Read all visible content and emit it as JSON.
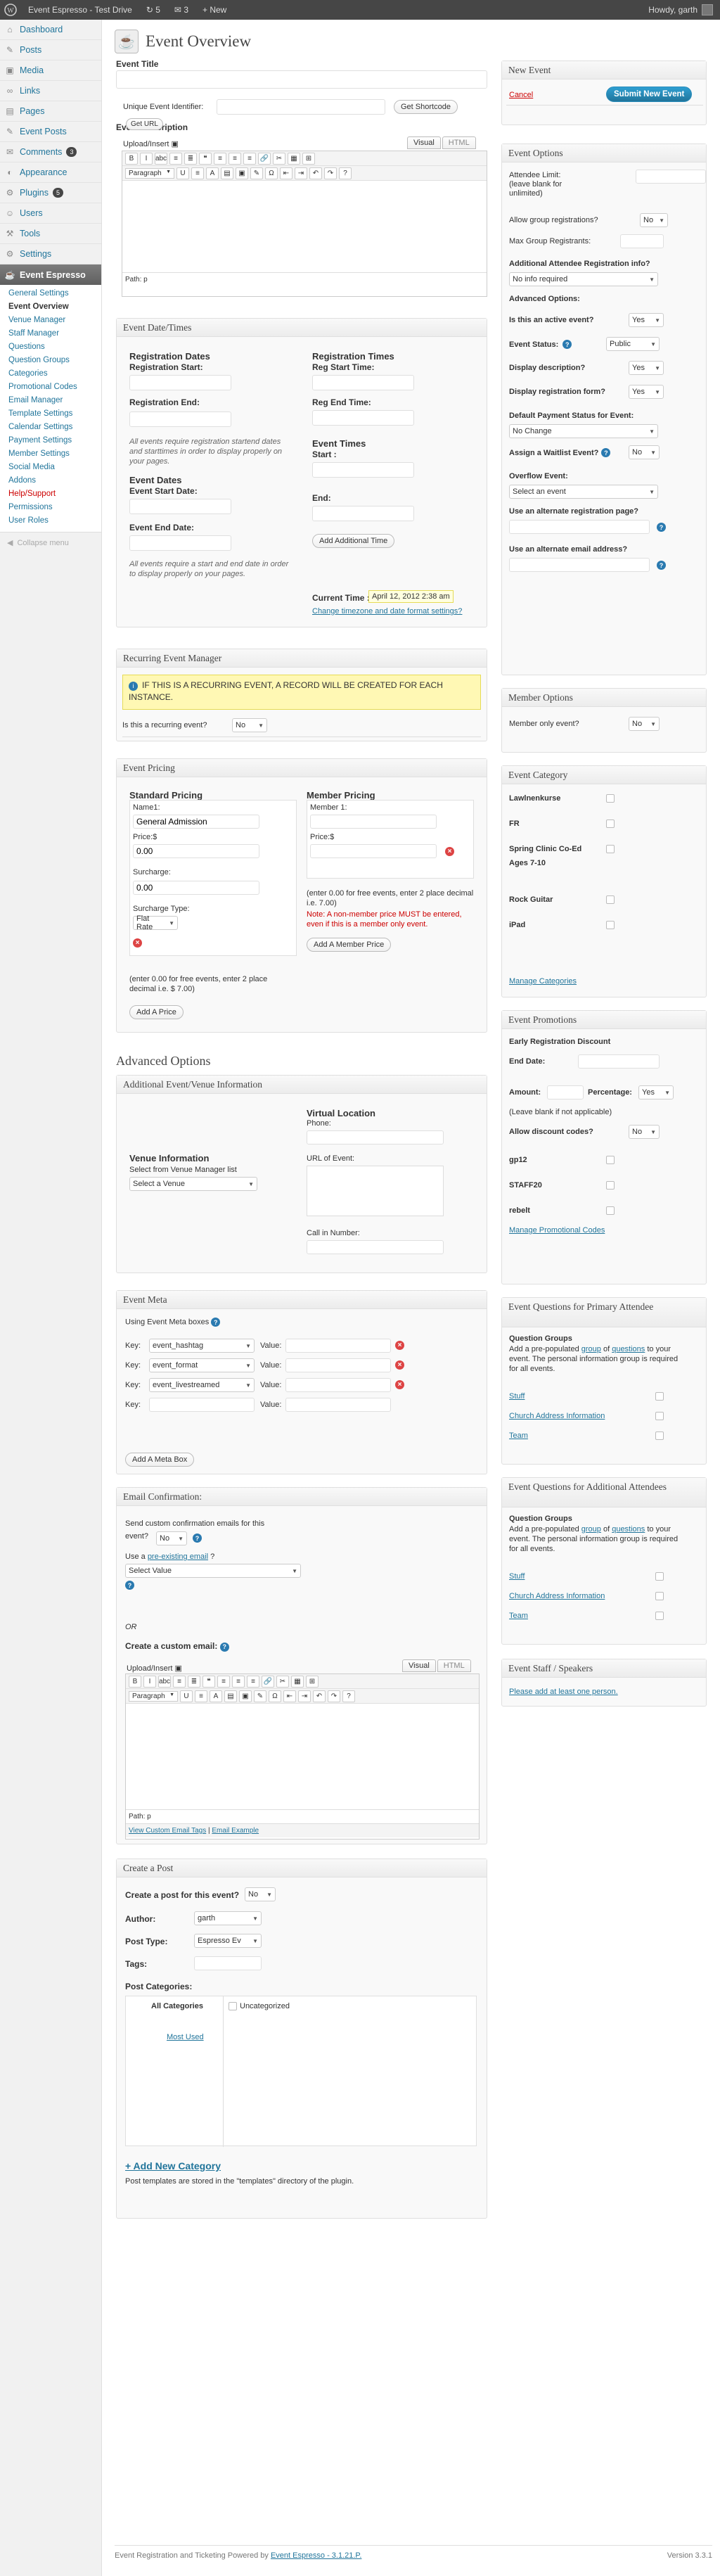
{
  "adminbar": {
    "site": "Event Espresso - Test Drive",
    "updates": "5",
    "comments": "3",
    "new": "+ New",
    "howdy": "Howdy, garth"
  },
  "menu": {
    "items": [
      {
        "label": "Dashboard",
        "icon": "⌂",
        "name": "dashboard"
      },
      {
        "label": "Posts",
        "icon": "✎",
        "name": "posts"
      },
      {
        "label": "Media",
        "icon": "▣",
        "name": "media"
      },
      {
        "label": "Links",
        "icon": "∞",
        "name": "links"
      },
      {
        "label": "Pages",
        "icon": "▤",
        "name": "pages"
      },
      {
        "label": "Event Posts",
        "icon": "✎",
        "name": "event-posts"
      },
      {
        "label": "Comments",
        "icon": "✉",
        "name": "comments",
        "badge": "3"
      },
      {
        "label": "Appearance",
        "icon": "◐",
        "name": "appearance"
      },
      {
        "label": "Plugins",
        "icon": "⚙",
        "name": "plugins",
        "badge": "5"
      },
      {
        "label": "Users",
        "icon": "☺",
        "name": "users"
      },
      {
        "label": "Tools",
        "icon": "⚒",
        "name": "tools"
      },
      {
        "label": "Settings",
        "icon": "⚙",
        "name": "settings"
      }
    ],
    "active": "Event Espresso",
    "subitems": [
      "General Settings",
      "Event Overview",
      "Venue Manager",
      "Staff Manager",
      "Questions",
      "Question Groups",
      "Categories",
      "Promotional Codes",
      "Email Manager",
      "Template Settings",
      "Calendar Settings",
      "Payment Settings",
      "Member Settings",
      "Social Media",
      "Addons",
      "Help/Support",
      "Permissions",
      "User Roles"
    ],
    "collapse": "Collapse menu"
  },
  "page": {
    "title": "Event Overview",
    "event_title_label": "Event Title",
    "uid_label": "Unique Event Identifier:",
    "shortcode_btn": "Get Shortcode",
    "desc_label": "Event Description",
    "geturl": "Get URL"
  },
  "editor": {
    "upload": "Upload/Insert",
    "visual": "Visual",
    "html": "HTML",
    "paragraph": "Paragraph",
    "path": "Path: p",
    "tb1": [
      "B",
      "I",
      "abc",
      "≡",
      "≣",
      "❝",
      "≡",
      "≡",
      "≡",
      "🔗",
      "✂",
      "▦",
      "⊞"
    ],
    "tb2": [
      "U",
      "≡",
      "A",
      "▤",
      "▣",
      "✎",
      "Ω",
      "⇤",
      "⇥",
      "↶",
      "↷",
      "?"
    ]
  },
  "datetimes": {
    "title": "Event Date/Times",
    "reg_dates": "Registration Dates",
    "reg_start": "Registration Start:",
    "reg_end": "Registration End:",
    "reg_note": "All events require registration startend dates and starttimes in order to display properly on your pages.",
    "ev_dates": "Event Dates",
    "ev_start": "Event Start Date:",
    "ev_end": "Event End Date:",
    "ev_note": "All events require a start and end date in order to display properly on your pages.",
    "reg_times": "Registration Times",
    "reg_start_time": "Reg Start Time:",
    "reg_end_time": "Reg End Time:",
    "ev_times": "Event Times",
    "start": "Start :",
    "end": "End:",
    "add_time": "Add Additional Time",
    "current_time_label": "Current Time :",
    "current_time": "April 12, 2012 2:38 am",
    "change_tz": "Change timezone and date format settings?"
  },
  "recurring": {
    "title": "Recurring Event Manager",
    "warning": "IF THIS IS A RECURRING EVENT, A RECORD WILL BE CREATED FOR EACH INSTANCE.",
    "question": "Is this a recurring event?",
    "value": "No"
  },
  "pricing": {
    "title": "Event Pricing",
    "standard": "Standard Pricing",
    "name_label": "Name1:",
    "name_value": "General Admission",
    "price_label": "Price:$",
    "price_value": "0.00",
    "surcharge_label": "Surcharge:",
    "surcharge_value": "0.00",
    "surcharge_type_label": "Surcharge Type:",
    "surcharge_type": "Flat Rate",
    "std_note": "(enter 0.00 for free events, enter 2 place decimal i.e. $ 7.00)",
    "add_price": "Add A Price",
    "member": "Member Pricing",
    "member_name": "Member 1:",
    "member_price": "Price:$",
    "member_note": "(enter 0.00 for free events, enter 2 place decimal i.e. 7.00)",
    "member_warn": "Note: A non-member price MUST be entered, even if this is a member only event.",
    "add_member": "Add A Member Price"
  },
  "advanced_title": "Advanced Options",
  "venue": {
    "title": "Additional Event/Venue Information",
    "venue_info": "Venue Information",
    "select_label": "Select from Venue Manager list",
    "select": "Select a Venue",
    "virtual": "Virtual Location",
    "phone": "Phone:",
    "url": "URL of Event:",
    "cell": "Call in Number:"
  },
  "meta": {
    "title": "Event Meta",
    "using": "Using Event Meta boxes",
    "key": "Key:",
    "value": "Value:",
    "keys": [
      "event_hashtag",
      "event_format",
      "event_livestreamed",
      ""
    ],
    "add": "Add A Meta Box"
  },
  "email": {
    "title": "Email Confirmation:",
    "send": "Send custom confirmation emails for this event?",
    "send_value": "No",
    "use": "Use a",
    "preexisting": "pre-existing email",
    "use_end": "?",
    "select": "Select Value",
    "or": "OR",
    "custom": "Create a custom email:",
    "view_tags": "View Custom Email Tags",
    "example": "Email Example"
  },
  "createpost": {
    "title": "Create a Post",
    "create": "Create a post for this event?",
    "create_value": "No",
    "author": "Author:",
    "author_value": "garth",
    "type": "Post Type:",
    "type_value": "Espresso Ev",
    "tags": "Tags:",
    "categories": "Post Categories:",
    "all_cats": "All Categories",
    "most_used": "Most Used",
    "uncategorized": "Uncategorized",
    "add_cat": "+ Add New Category",
    "templates_note": "Post templates are stored in the \"templates\" directory of the plugin."
  },
  "newevent": {
    "title": "New Event",
    "cancel": "Cancel",
    "submit": "Submit New Event"
  },
  "options": {
    "title": "Event Options",
    "limit": "Attendee Limit:",
    "limit_note": "(leave blank for unlimited)",
    "group": "Allow group registrations?",
    "group_value": "No",
    "max_group": "Max Group Registrants:",
    "additional": "Additional Attendee Registration info?",
    "additional_value": "No info required",
    "advanced": "Advanced Options:",
    "active": "Is this an active event?",
    "active_value": "Yes",
    "status": "Event Status:",
    "status_value": "Public",
    "display_desc": "Display description?",
    "display_desc_value": "Yes",
    "display_form": "Display registration form?",
    "display_form_value": "Yes",
    "payment_status": "Default Payment Status for Event:",
    "payment_value": "No Change",
    "waitlist": "Assign a Waitlist Event?",
    "waitlist_value": "No",
    "overflow": "Overflow Event:",
    "overflow_value": "Select an event",
    "alt_reg": "Use an alternate registration page?",
    "alt_email": "Use an alternate email address?"
  },
  "member_options": {
    "title": "Member Options",
    "member_only": "Member only event?",
    "member_only_value": "No"
  },
  "category": {
    "title": "Event Category",
    "items": [
      "Lawlnenkurse",
      "FR",
      "Spring Clinic Co-Ed",
      "Ages 7-10",
      "Rock Guitar",
      "iPad"
    ],
    "manage": "Manage Categories"
  },
  "promotions": {
    "title": "Event Promotions",
    "early": "Early Registration Discount",
    "end_date": "End Date:",
    "amount": "Amount:",
    "percentage": "Percentage:",
    "percentage_value": "Yes",
    "blank_note": "(Leave blank if not applicable)",
    "allow": "Allow discount codes?",
    "allow_value": "No",
    "codes": [
      "gp12",
      "STAFF20",
      "rebelt"
    ],
    "manage": "Manage Promotional Codes"
  },
  "questions_primary": {
    "title": "Event Questions for Primary Attendee",
    "groups": "Question Groups",
    "desc_a": "Add a pre-populated",
    "group_link": "group",
    "desc_b": "of",
    "questions_link": "questions",
    "desc_c": "to your event. The personal information group is required for all events.",
    "items": [
      "Stuff",
      "Church Address Information",
      "Team"
    ]
  },
  "questions_additional": {
    "title": "Event Questions for Additional Attendees",
    "groups": "Question Groups",
    "desc_a": "Add a pre-populated",
    "group_link": "group",
    "desc_b": "of",
    "questions_link": "questions",
    "desc_c": "to your event. The personal information group is required for all events.",
    "items": [
      "Stuff",
      "Church Address Information",
      "Team"
    ]
  },
  "staff": {
    "title": "Event Staff / Speakers",
    "add": "Please add at least one person."
  },
  "footer": {
    "left_a": "Event Registration and Ticketing Powered by",
    "left_link": "Event Espresso - 3.1.21.P.",
    "right": "Version 3.3.1"
  }
}
